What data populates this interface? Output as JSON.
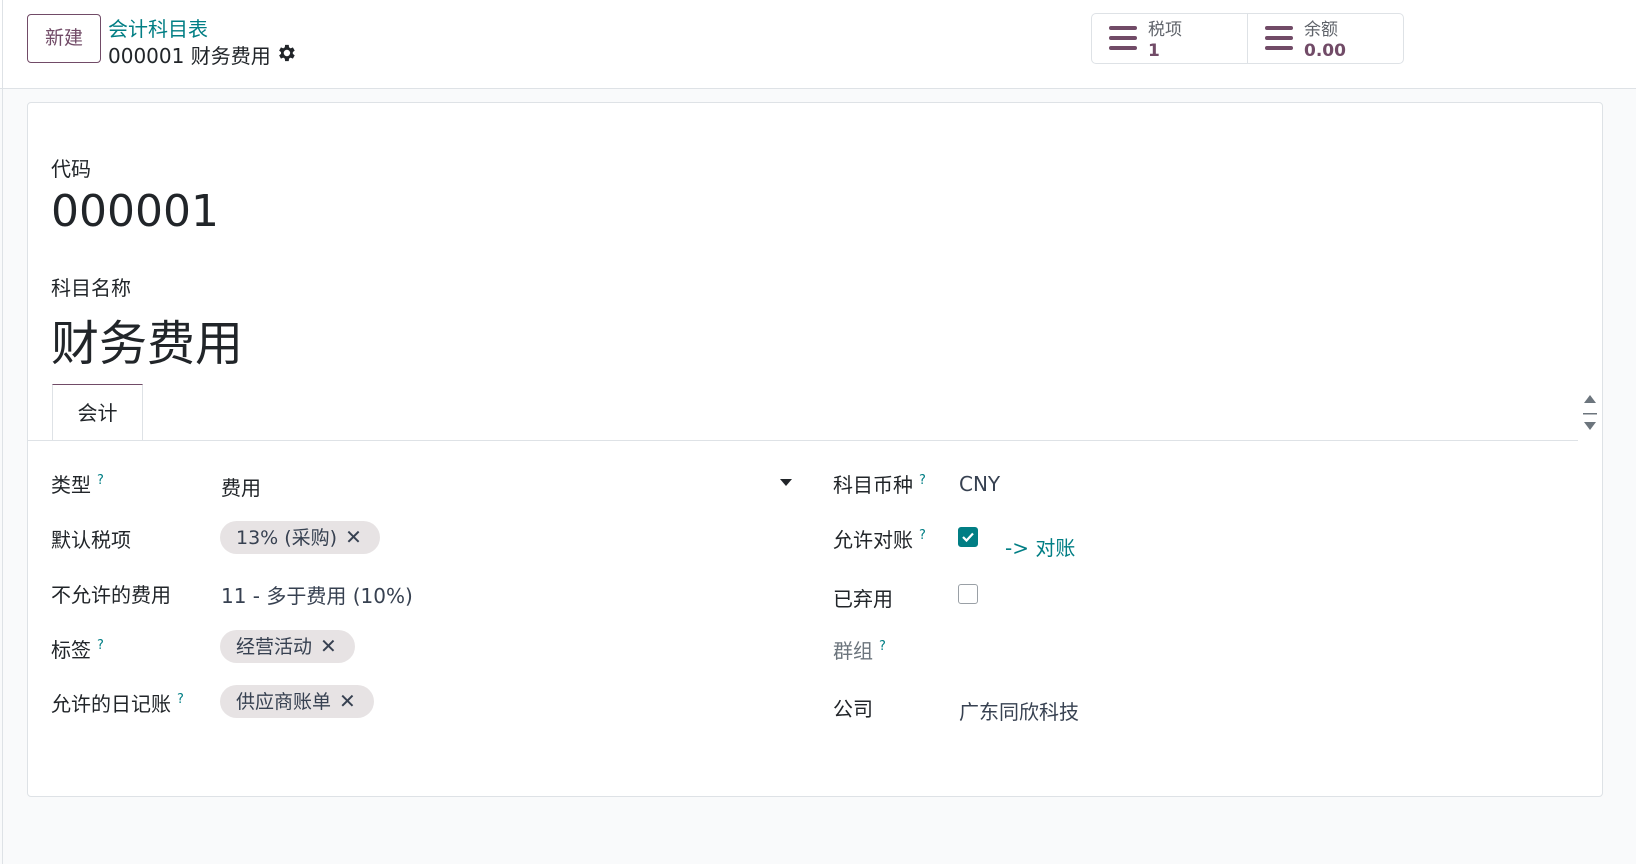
{
  "header": {
    "new_button": "新建",
    "breadcrumb_parent": "会计科目表",
    "breadcrumb_current": "000001 财务费用"
  },
  "smart_buttons": [
    {
      "icon": "list-icon",
      "label": "税项",
      "value": "1"
    },
    {
      "icon": "list-icon",
      "label": "余额",
      "value": "0.00"
    }
  ],
  "form": {
    "code_label": "代码",
    "code_value": "000001",
    "name_label": "科目名称",
    "name_value": "财务费用",
    "tab_label": "会计",
    "help_mark": "?",
    "left": {
      "type_label": "类型",
      "type_value": "费用",
      "default_tax_label": "默认税项",
      "default_tax_tag": "13% (采购)",
      "disallowed_label": "不允许的费用",
      "disallowed_value": "11 - 多于费用 (10%)",
      "tags_label": "标签",
      "tags_tag": "经营活动",
      "journals_label": "允许的日记账",
      "journals_tag": "供应商账单"
    },
    "right": {
      "currency_label": "科目币种",
      "currency_value": "CNY",
      "reconcile_label": "允许对账",
      "reconcile_checked": true,
      "reconcile_link": "-> 对账",
      "deprecated_label": "已弃用",
      "deprecated_checked": false,
      "group_label": "群组",
      "company_label": "公司",
      "company_value": "广东同欣科技"
    }
  },
  "colors": {
    "brand": "#714b67",
    "accent": "#017e84",
    "tag_bg": "#e7e3e4"
  }
}
